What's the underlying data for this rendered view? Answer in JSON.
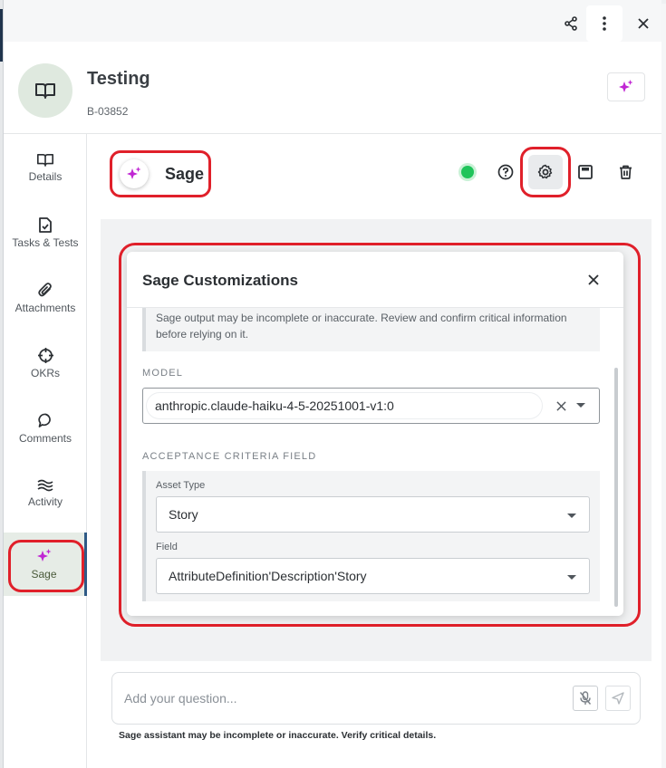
{
  "colors": {
    "sage_accent": "#c026d3",
    "highlight": "#e0202a",
    "status_online": "#1fc45a",
    "active_nav_bar": "#2f5a86"
  },
  "topbar": {
    "share_icon": "share-icon",
    "more_icon": "more-vertical-icon",
    "close_icon": "close-icon"
  },
  "header": {
    "title": "Testing",
    "id": "B-03852",
    "avatar_icon": "book-open-icon",
    "sage_button_icon": "sparkle-icon"
  },
  "sidebar": {
    "items": [
      {
        "label": "Details",
        "icon": "book-open-icon"
      },
      {
        "label": "Tasks & Tests",
        "icon": "file-check-icon"
      },
      {
        "label": "Attachments",
        "icon": "paperclip-icon"
      },
      {
        "label": "OKRs",
        "icon": "crosshair-icon"
      },
      {
        "label": "Comments",
        "icon": "speech-bubble-icon"
      },
      {
        "label": "Activity",
        "icon": "activity-waves-icon"
      },
      {
        "label": "Sage",
        "icon": "sparkle-icon",
        "active": true
      }
    ]
  },
  "sage": {
    "name": "Sage",
    "toolbar": {
      "status": "online",
      "help_icon": "help-circle-icon",
      "settings_icon": "gear-icon",
      "save_icon": "save-icon",
      "delete_icon": "trash-icon"
    }
  },
  "modal": {
    "title": "Sage Customizations",
    "warning": "Sage output may be incomplete or inaccurate. Review and confirm critical information before relying on it.",
    "model_label": "MODEL",
    "model_value": "anthropic.claude-haiku-4-5-20251001-v1:0",
    "criteria_label": "ACCEPTANCE CRITERIA FIELD",
    "asset_type_label": "Asset Type",
    "asset_type_value": "Story",
    "field_label": "Field",
    "field_value": "AttributeDefinition'Description'Story"
  },
  "composer": {
    "placeholder": "Add your question...",
    "disclaimer": "Sage assistant may be incomplete or inaccurate. Verify critical details."
  }
}
